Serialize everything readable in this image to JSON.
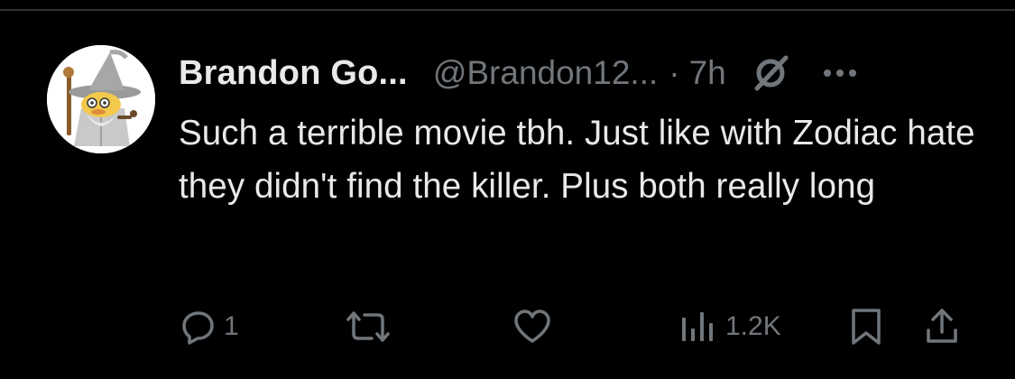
{
  "post": {
    "author_name": "Brandon Go...",
    "author_handle": "@Brandon12...",
    "separator": "·",
    "timestamp": "7h",
    "text": "Such a terrible movie tbh. Just like with Zodiac hate they didn't find the killer. Plus both really long",
    "avatar": "wizard-character-avatar",
    "header_icons": [
      "nope-slash-icon",
      "more-horizontal-icon"
    ]
  },
  "actions": {
    "reply_count": "1",
    "views_count": "1.2K",
    "icons": [
      "reply-icon",
      "repost-icon",
      "like-icon",
      "views-icon",
      "bookmark-icon",
      "share-icon"
    ]
  },
  "colors": {
    "background": "#000000",
    "text_primary": "#e7e9ea",
    "text_secondary": "#71767b",
    "divider": "#2f3336"
  }
}
